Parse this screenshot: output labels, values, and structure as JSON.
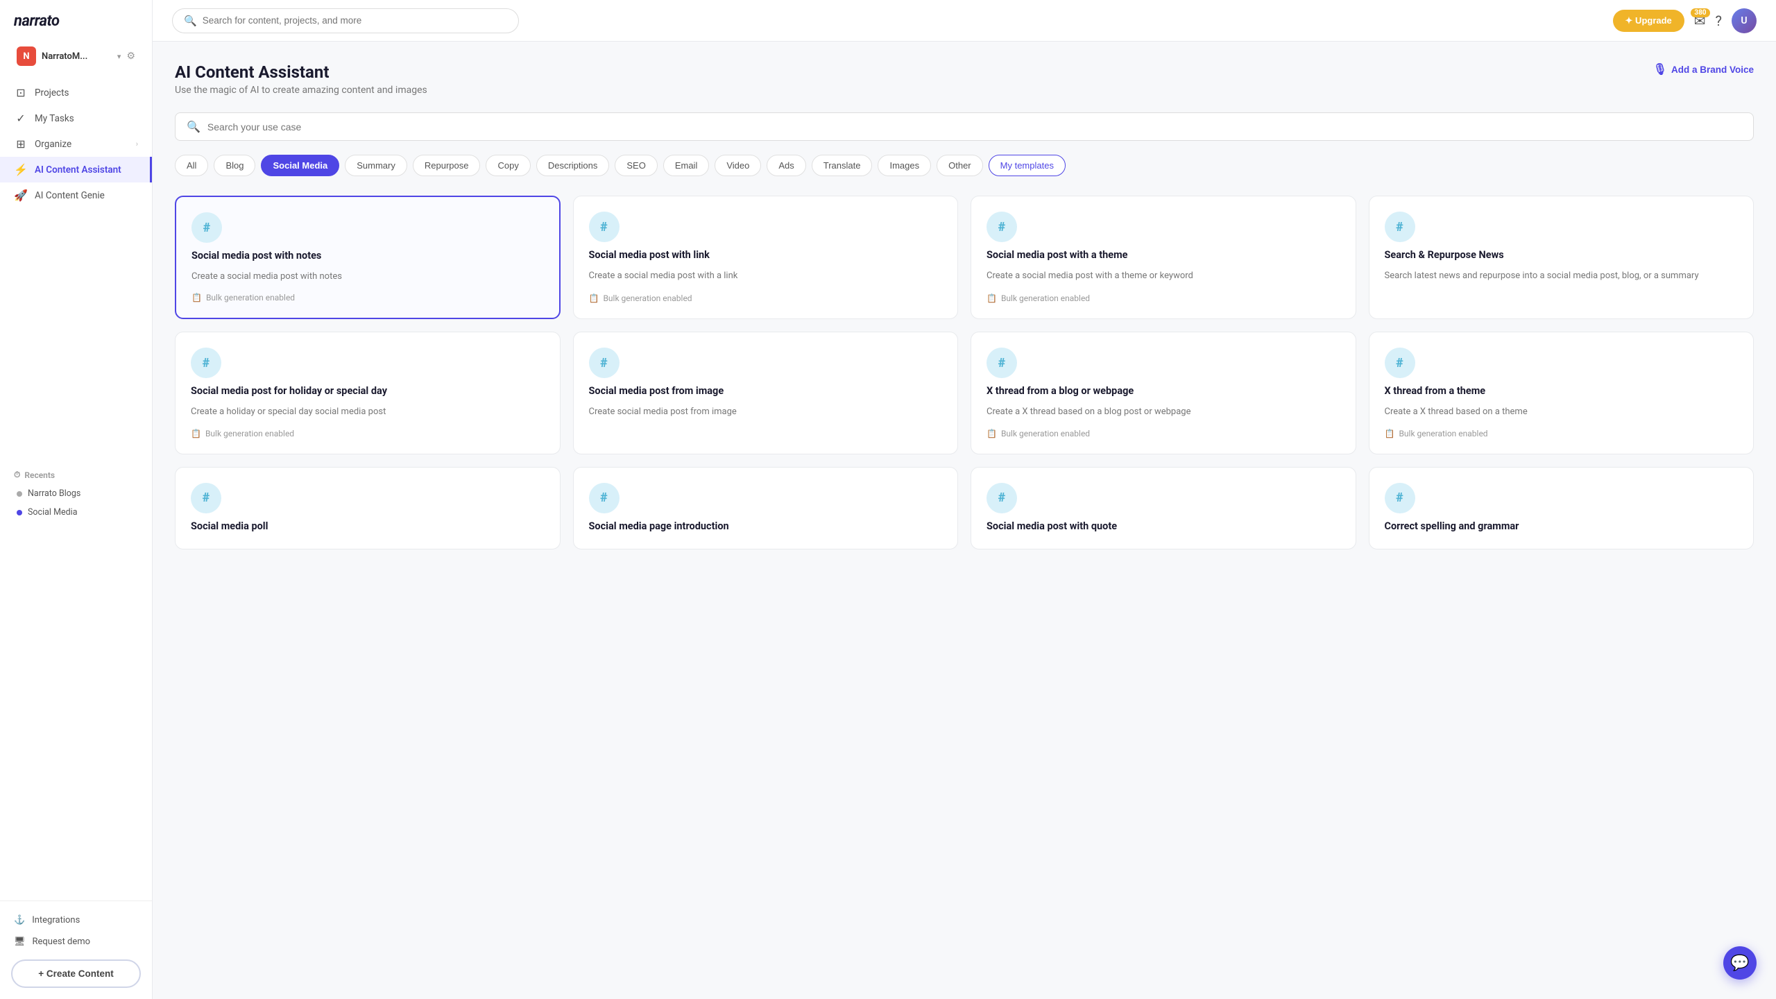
{
  "app": {
    "name": "narrato"
  },
  "workspace": {
    "avatar_letter": "N",
    "name": "NarratoM...",
    "chevron": "▾"
  },
  "sidebar": {
    "nav_items": [
      {
        "id": "projects",
        "icon": "⊡",
        "label": "Projects"
      },
      {
        "id": "my-tasks",
        "icon": "✓",
        "label": "My Tasks"
      },
      {
        "id": "organize",
        "icon": "⊞",
        "label": "Organize",
        "has_arrow": true
      },
      {
        "id": "ai-content-assistant",
        "icon": "⚡",
        "label": "AI Content Assistant",
        "active": true
      },
      {
        "id": "ai-content-genie",
        "icon": "🚀",
        "label": "AI Content Genie"
      }
    ],
    "recents_label": "Recents",
    "recents": [
      {
        "id": "narrato-blogs",
        "label": "Narrato Blogs",
        "color": "gray"
      },
      {
        "id": "social-media",
        "label": "Social Media",
        "color": "blue"
      }
    ],
    "bottom_items": [
      {
        "id": "integrations",
        "icon": "⚓",
        "label": "Integrations"
      },
      {
        "id": "request-demo",
        "icon": "🖥",
        "label": "Request demo"
      }
    ],
    "create_btn": "+ Create Content"
  },
  "topbar": {
    "search_placeholder": "Search for content, projects, and more",
    "upgrade_label": "✦ Upgrade",
    "notif_count": "380",
    "notif_icon": "✉",
    "help_icon": "?"
  },
  "main": {
    "title": "AI Content Assistant",
    "subtitle": "Use the magic of AI to create amazing content and images",
    "brand_voice_label": "Add a Brand Voice",
    "usecase_search_placeholder": "Search your use case",
    "filter_tabs": [
      {
        "id": "all",
        "label": "All",
        "active": false
      },
      {
        "id": "blog",
        "label": "Blog",
        "active": false
      },
      {
        "id": "social-media",
        "label": "Social Media",
        "active": true
      },
      {
        "id": "summary",
        "label": "Summary",
        "active": false
      },
      {
        "id": "repurpose",
        "label": "Repurpose",
        "active": false
      },
      {
        "id": "copy",
        "label": "Copy",
        "active": false
      },
      {
        "id": "descriptions",
        "label": "Descriptions",
        "active": false
      },
      {
        "id": "seo",
        "label": "SEO",
        "active": false
      },
      {
        "id": "email",
        "label": "Email",
        "active": false
      },
      {
        "id": "video",
        "label": "Video",
        "active": false
      },
      {
        "id": "ads",
        "label": "Ads",
        "active": false
      },
      {
        "id": "translate",
        "label": "Translate",
        "active": false
      },
      {
        "id": "images",
        "label": "Images",
        "active": false
      },
      {
        "id": "other",
        "label": "Other",
        "active": false
      },
      {
        "id": "my-templates",
        "label": "My templates",
        "active": false,
        "special": true
      }
    ],
    "cards": [
      {
        "id": "social-notes",
        "title": "Social media post with notes",
        "desc": "Create a social media post with notes",
        "bulk": "Bulk generation enabled",
        "selected": true
      },
      {
        "id": "social-link",
        "title": "Social media post with link",
        "desc": "Create a social media post with a link",
        "bulk": "Bulk generation enabled",
        "selected": false
      },
      {
        "id": "social-theme",
        "title": "Social media post with a theme",
        "desc": "Create a social media post with a theme or keyword",
        "bulk": "Bulk generation enabled",
        "selected": false
      },
      {
        "id": "search-repurpose",
        "title": "Search & Repurpose News",
        "desc": "Search latest news and repurpose into a social media post, blog, or a summary",
        "bulk": null,
        "selected": false
      },
      {
        "id": "social-holiday",
        "title": "Social media post for holiday or special day",
        "desc": "Create a holiday or special day social media post",
        "bulk": "Bulk generation enabled",
        "selected": false
      },
      {
        "id": "social-image",
        "title": "Social media post from image",
        "desc": "Create social media post from image",
        "bulk": null,
        "selected": false
      },
      {
        "id": "x-thread-blog",
        "title": "X thread from a blog or webpage",
        "desc": "Create a X thread based on a blog post or webpage",
        "bulk": "Bulk generation enabled",
        "selected": false
      },
      {
        "id": "x-thread-theme",
        "title": "X thread from a theme",
        "desc": "Create a X thread based on a theme",
        "bulk": "Bulk generation enabled",
        "selected": false
      },
      {
        "id": "social-poll",
        "title": "Social media poll",
        "desc": "",
        "bulk": null,
        "selected": false
      },
      {
        "id": "social-page-intro",
        "title": "Social media page introduction",
        "desc": "",
        "bulk": null,
        "selected": false
      },
      {
        "id": "social-quote",
        "title": "Social media post with quote",
        "desc": "",
        "bulk": null,
        "selected": false
      },
      {
        "id": "correct-grammar",
        "title": "Correct spelling and grammar",
        "desc": "",
        "bulk": null,
        "selected": false
      }
    ]
  }
}
